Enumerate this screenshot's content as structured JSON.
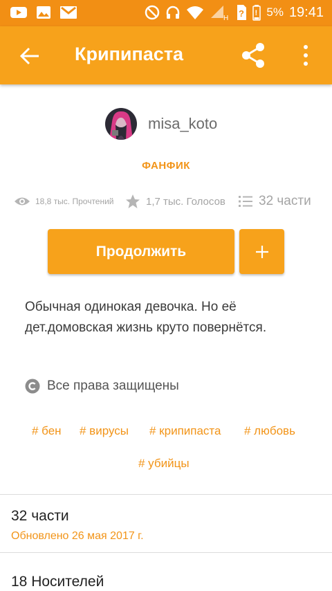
{
  "status_bar": {
    "battery_percent": "5%",
    "time": "19:41",
    "left_icons": [
      "youtube-icon",
      "gallery-icon",
      "gmail-icon"
    ],
    "right_icons": [
      "do-not-disturb-icon",
      "headset-icon",
      "wifi-icon",
      "signal-icon",
      "unknown-sim-icon",
      "battery-icon"
    ]
  },
  "toolbar": {
    "title": "Крипипаста",
    "back_icon": "arrow-back-icon",
    "share_icon": "share-icon",
    "more_icon": "more-vertical-icon"
  },
  "story": {
    "author": "misa_koto",
    "category": "ФАНФИК",
    "reads": "18,8 тыс. Прочтений",
    "votes": "1,7 тыс. Голосов",
    "parts": "32 части",
    "continue_label": "Продолжить",
    "add_label": "+",
    "description": "Обычная одинокая девочка. Но её дет.домовская жизнь круто повернётся.",
    "rights": "Все права защищены",
    "tags": [
      "# бен",
      "# вирусы",
      "# крипипаста",
      "# любовь",
      "# убийцы"
    ]
  },
  "sections": {
    "parts_title": "32 части",
    "updated": "Обновлено 26 мая 2017 г.",
    "carriers_title": "18 Носителей"
  },
  "colors": {
    "status_bar": "#f28f14",
    "toolbar": "#f7a21b",
    "accent": "#f29418"
  }
}
